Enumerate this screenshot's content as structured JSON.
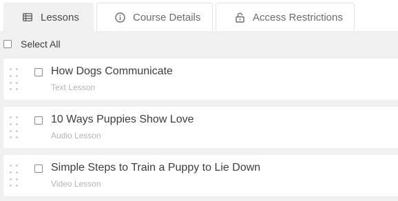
{
  "tabs": [
    {
      "label": "Lessons",
      "icon": "table-icon",
      "active": true
    },
    {
      "label": "Course Details",
      "icon": "info-circle-icon",
      "active": false
    },
    {
      "label": "Access Restrictions",
      "icon": "lock-icon",
      "active": false
    }
  ],
  "select_all": {
    "label": "Select All",
    "checked": false
  },
  "lessons": [
    {
      "title": "How Dogs Communicate",
      "type": "Text Lesson",
      "checked": false
    },
    {
      "title": "10 Ways Puppies Show Love",
      "type": "Audio Lesson",
      "checked": false
    },
    {
      "title": "Simple Steps to Train a Puppy to Lie Down",
      "type": "Video Lesson",
      "checked": false
    }
  ],
  "colors": {
    "panel_bg": "#f0f0f0",
    "card_bg": "#ffffff",
    "title_text": "#3d3d3d",
    "subtitle_text": "#b5b5b5",
    "handle_dots": "#c8cbd3"
  }
}
